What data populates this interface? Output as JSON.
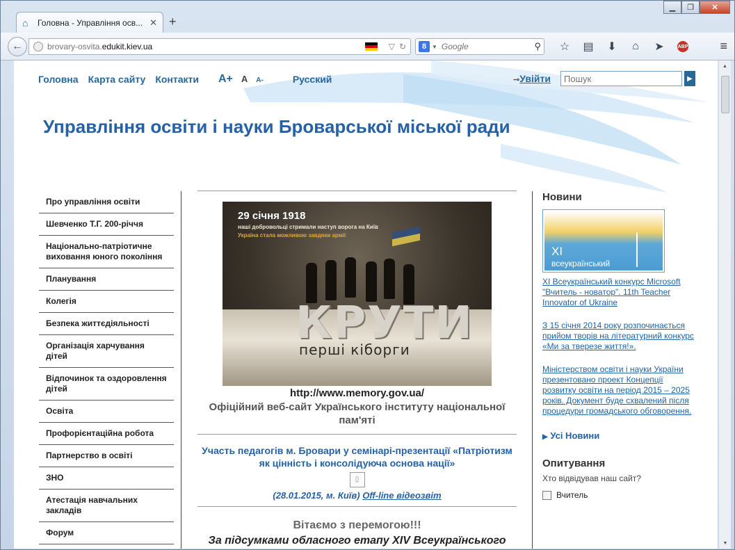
{
  "browser": {
    "tab_title": "Головна - Управління осв...",
    "tab_close": "✕",
    "new_tab": "+",
    "url_prefix": "brovary-osvita.",
    "url_domain": "edukit.kiev.ua",
    "search_engine_letter": "8",
    "search_placeholder": "Google",
    "win_minimize": "▁",
    "win_maximize": "❐",
    "win_close": "✕"
  },
  "site": {
    "nav": [
      "Головна",
      "Карта сайту",
      "Контакти"
    ],
    "font_sizes": [
      "A+",
      "A",
      "A-"
    ],
    "lang": "Русский",
    "login": "Увійти",
    "search_placeholder": "Пошук",
    "title": "Управління освіти і науки Броварської міської ради"
  },
  "left_menu": [
    "Про управління освіти",
    "Шевченко Т.Г. 200-річчя",
    "Національно-патріотичне виховання юного покоління",
    "Планування",
    "Колегія",
    "Безпека життєдіяльності",
    "Організація харчування дітей",
    "Відпочинок та оздоровлення дітей",
    "Освіта",
    "Профорієнтаційна робота",
    "Партнерство в освіті",
    "ЗНО",
    "Атестація навчальних закладів",
    "Форум"
  ],
  "center": {
    "poster": {
      "date": "29 січня 1918",
      "line1": "наші добровольці стримали наступ ворога на Київ",
      "line2": "Україна стала можливою завдяки армії",
      "big_word": "КРУТИ",
      "subtitle": "перші кіборги"
    },
    "memory_url": "http://www.memory.gov.ua/",
    "memory_desc": "Офіційний веб-сайт Українського інституту національної пам'яті",
    "news_title": "Участь педагогів м. Бровари у семінарі-презентації «Патріотизм як цінність і консолідуюча основа нації»",
    "video_date": "(28.01.2015, м. Київ)",
    "video_link": "Off-line відеозвіт",
    "congrats": "Вітаємо з перемогою!!!",
    "congrats_text": "За підсумками обласного етапу XIV Всеукраїнського"
  },
  "right": {
    "news_heading": "Новини",
    "news_img_roman": "XI",
    "news_img_word": "всеукраїнський",
    "news": [
      "XI Всеукраїнський конкурс Microsoft \"Вчитель - новатор\". 11th Teacher Innovator of Ukraine",
      "З 15 січня 2014 року розпочинається прийом творів на літературний конкурс «Ми за тверезе життя!».",
      "Міністерством освіти і науки України презентовано проект Концепції розвитку освіти на період 2015 – 2025 років. Документ буде схвалений після процедури громадського обговорення."
    ],
    "all_news": "Усі Новини",
    "poll_heading": "Опитування",
    "poll_question": "Хто відвідував наш сайт?",
    "poll_option": "Вчитель"
  },
  "colors": {
    "accent": "#2461a6",
    "link": "#1f64a8"
  }
}
